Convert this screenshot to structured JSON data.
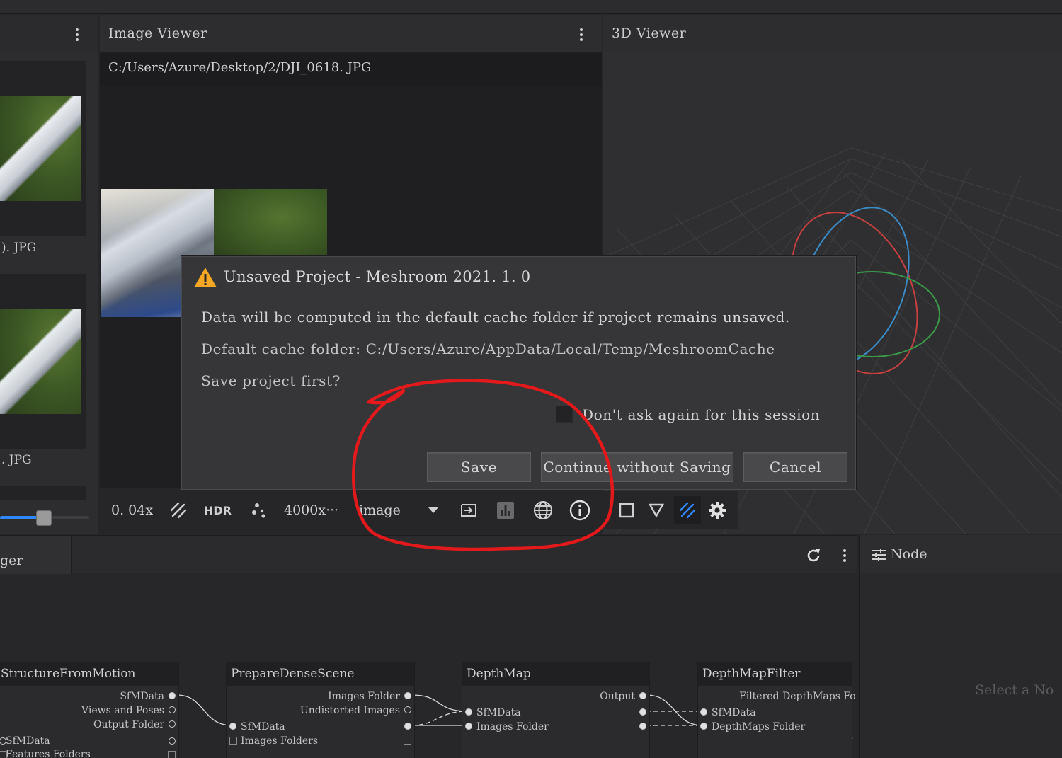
{
  "left_panel": {
    "thumbnails": [
      {
        "label": "). JPG"
      },
      {
        "label": ". JPG"
      }
    ],
    "zoom_slider": {
      "value": 0.45
    }
  },
  "image_viewer": {
    "title": "Image Viewer",
    "path": "C:/Users/Azure/Desktop/2/DJI_0618. JPG",
    "toolbar": {
      "zoom": "0. 04x",
      "hdr_label": "HDR",
      "resolution": "4000x···",
      "image_select": "image"
    }
  },
  "viewer_3d": {
    "title": "3D Viewer"
  },
  "dialog": {
    "title": "Unsaved Project - Meshroom 2021. 1. 0",
    "message": "Data will be computed in the default cache folder if project remains unsaved.",
    "cache_folder": "Default cache folder: C:/Users/Azure/AppData/Local/Temp/MeshroomCache",
    "question": "Save project first?",
    "dont_ask_label": "Don't ask again for this session",
    "buttons": {
      "save": "Save",
      "continue": "Continue without Saving",
      "cancel": "Cancel"
    }
  },
  "graph_editor": {
    "tab_label": "ger",
    "nodes": [
      {
        "title": "StructureFromMotion",
        "outputs": [
          "SfMData",
          "Views and Poses",
          "Output Folder"
        ],
        "inputs": [
          "SfMData",
          "Features Folders"
        ]
      },
      {
        "title": "PrepareDenseScene",
        "outputs": [
          "Images Folder",
          "Undistorted Images"
        ],
        "inputs": [
          "SfMData",
          "Images Folders"
        ]
      },
      {
        "title": "DepthMap",
        "outputs": [
          "Output"
        ],
        "inputs": [
          "SfMData",
          "Images Folder"
        ]
      },
      {
        "title": "DepthMapFilter",
        "outputs": [
          "Filtered DepthMaps Fo"
        ],
        "inputs": [
          "SfMData",
          "DepthMaps Folder"
        ]
      }
    ]
  },
  "node_panel": {
    "title": "Node",
    "placeholder": "Select a No"
  },
  "colors": {
    "accent_blue": "#2f86ff",
    "warning_orange": "#f5a623",
    "annotation_red": "#e3191c"
  }
}
